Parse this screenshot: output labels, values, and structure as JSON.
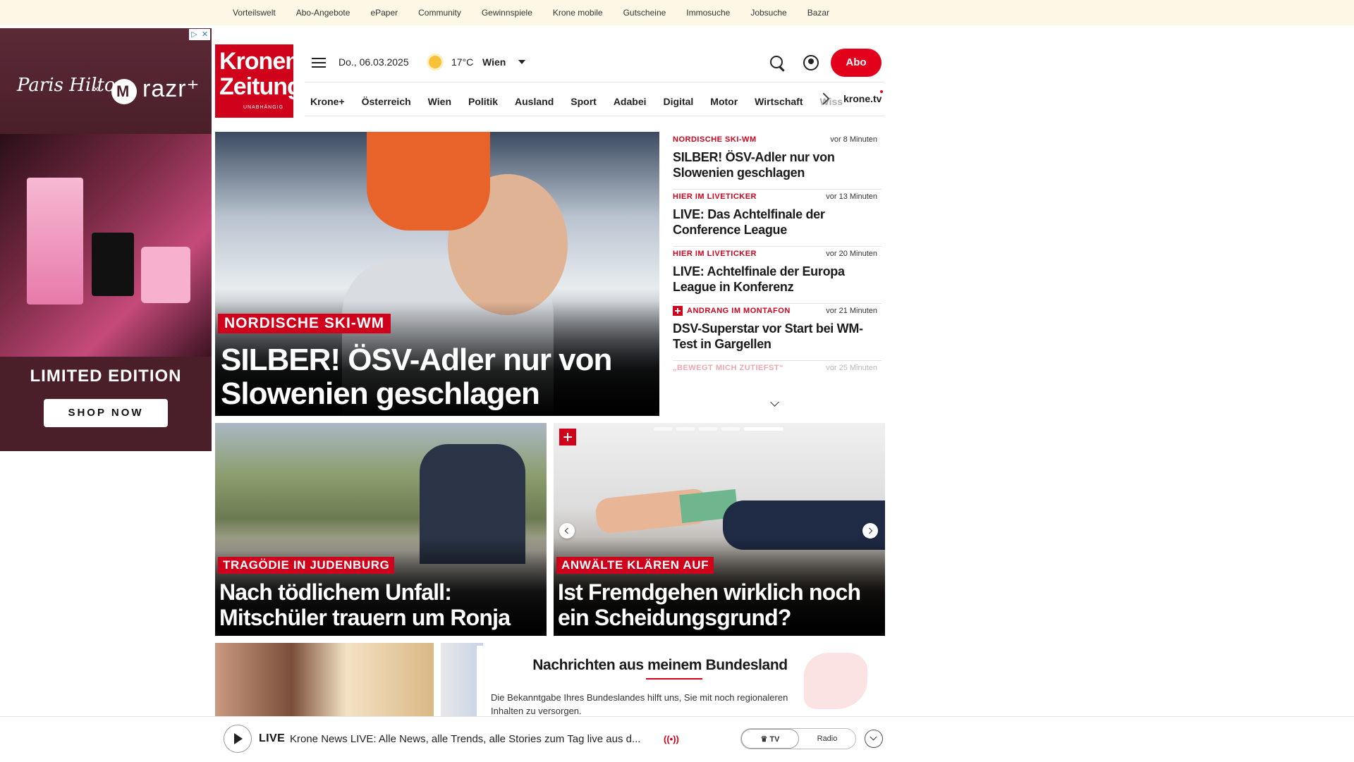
{
  "topbar": {
    "links": [
      "Vorteilswelt",
      "Abo-Angebote",
      "ePaper",
      "Community",
      "Gewinnspiele",
      "Krone mobile",
      "Gutscheine",
      "Immosuche",
      "Jobsuche",
      "Bazar"
    ]
  },
  "ad": {
    "signature": "Paris Hilton",
    "x": "×",
    "brand": "razr⁺",
    "adchoices": "▷",
    "close": "✕",
    "headline": "LIMITED EDITION",
    "cta": "SHOP NOW"
  },
  "header": {
    "logo_line1": "Kronen",
    "logo_line2": "Zeitung",
    "logo_tagline": "UNABHÄNGIG",
    "date": "Do., 06.03.2025",
    "temperature": "17°C",
    "city": "Wien",
    "abo_label": "Abo"
  },
  "nav": {
    "items": [
      "Krone+",
      "Österreich",
      "Wien",
      "Politik",
      "Ausland",
      "Sport",
      "Adabei",
      "Digital",
      "Motor",
      "Wirtschaft"
    ],
    "truncated": "Wiss",
    "krone_tv": "krone.tv"
  },
  "hero": {
    "kicker": "NORDISCHE SKI-WM",
    "title": "SILBER! ÖSV-Adler nur von Slowenien geschlagen"
  },
  "ticker": [
    {
      "kicker": "NORDISCHE SKI-WM",
      "time": "vor 8 Minuten",
      "title": "SILBER! ÖSV-Adler nur von Slowenien geschlagen"
    },
    {
      "kicker": "HIER IM LIVETICKER",
      "time": "vor 13 Minuten",
      "title": "LIVE: Das Achtelfinale der Conference League"
    },
    {
      "kicker": "HIER IM LIVETICKER",
      "time": "vor 20 Minuten",
      "title": "LIVE: Achtelfinale der Europa League in Konferenz"
    },
    {
      "kicker": "ANDRANG IM MONTAFON",
      "time": "vor 21 Minuten",
      "title": "DSV-Superstar vor Start bei WM-Test in Gargellen"
    },
    {
      "kicker": "„BEWEGT MICH ZUTIEFST“",
      "time": "vor 25 Minuten",
      "title": ""
    }
  ],
  "cards": [
    {
      "kicker": "TRAGÖDIE IN JUDENBURG",
      "title": "Nach tödlichem Unfall: Mitschüler trauern um Ronja"
    },
    {
      "kicker": "ANWÄLTE KLÄREN AUF",
      "title": "Ist Fremdgehen wirklich noch ein Scheidungsgrund?"
    }
  ],
  "region": {
    "title": "Nachrichten aus meinem Bundesland",
    "text": "Die Bekanntgabe Ihres Bundeslandes hilft uns, Sie mit noch regionaleren Inhalten zu versorgen."
  },
  "player": {
    "live_label": "LIVE",
    "text": "Krone News LIVE: Alle News, alle Trends, alle Stories zum Tag live aus d...",
    "wave": "((•))",
    "tv_label": "TV",
    "radio_label": "Radio"
  },
  "colors": {
    "brand_red": "#d0021b",
    "topbar_bg": "#fdf7e6"
  }
}
